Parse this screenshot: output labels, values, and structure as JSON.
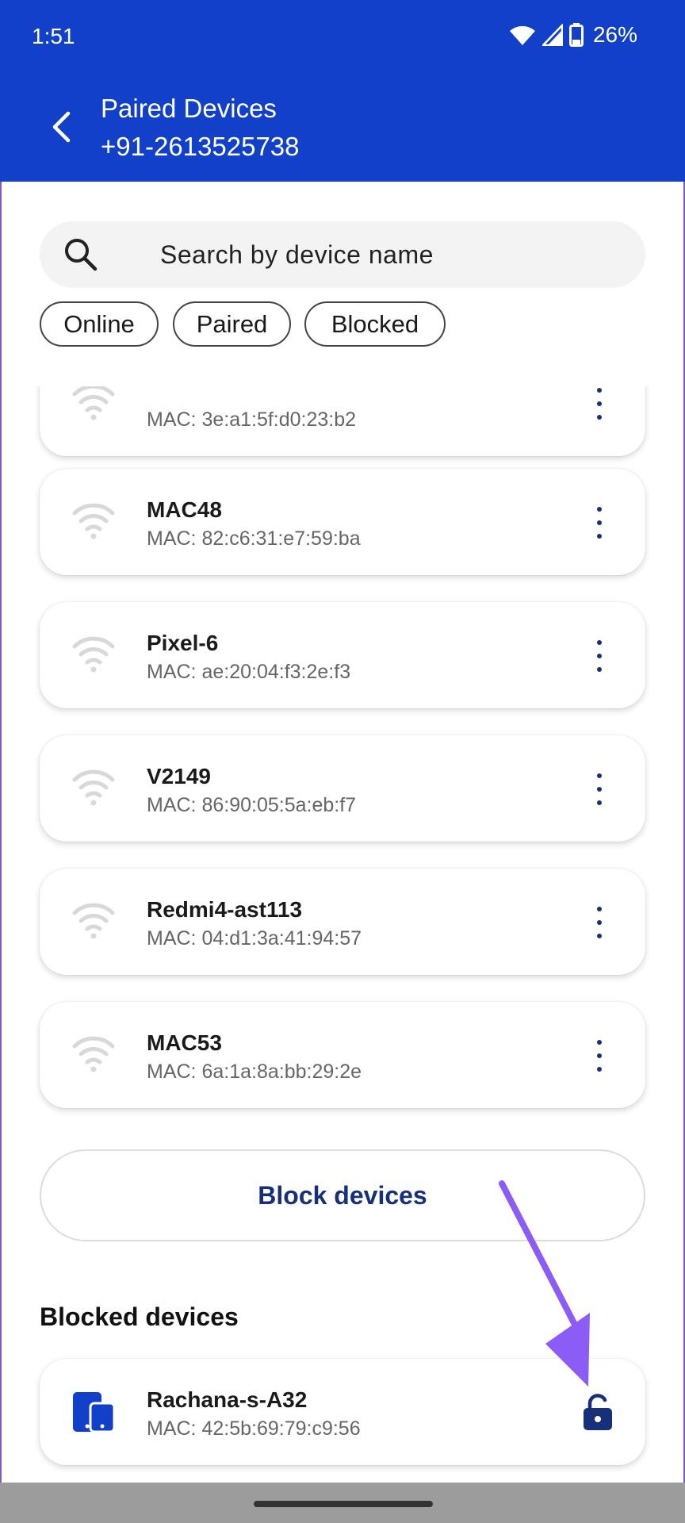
{
  "status_bar": {
    "time": "1:51",
    "battery": "26%",
    "icons": [
      "wifi-icon",
      "cell-signal-icon",
      "battery-icon"
    ]
  },
  "header": {
    "title": "Paired Devices",
    "subtitle": "+91-2613525738",
    "back_icon": "back-arrow-icon"
  },
  "search": {
    "placeholder": "Search by device name",
    "icon": "search-icon"
  },
  "filters": [
    {
      "label": "Online"
    },
    {
      "label": "Paired"
    },
    {
      "label": "Blocked"
    }
  ],
  "devices": [
    {
      "name": "",
      "mac": "MAC: 3e:a1:5f:d0:23:b2"
    },
    {
      "name": "MAC48",
      "mac": "MAC: 82:c6:31:e7:59:ba"
    },
    {
      "name": "Pixel-6",
      "mac": "MAC: ae:20:04:f3:2e:f3"
    },
    {
      "name": "V2149",
      "mac": "MAC: 86:90:05:5a:eb:f7"
    },
    {
      "name": "Redmi4-ast113",
      "mac": "MAC: 04:d1:3a:41:94:57"
    },
    {
      "name": "MAC53",
      "mac": "MAC: 6a:1a:8a:bb:29:2e"
    }
  ],
  "block_button": {
    "label": "Block devices"
  },
  "blocked_section": {
    "title": "Blocked devices",
    "devices": [
      {
        "name": "Rachana-s-A32",
        "mac": "MAC: 42:5b:69:79:c9:56"
      }
    ]
  },
  "colors": {
    "header_bg": "#1240c8",
    "accent_dark": "#17307a",
    "annotation_arrow": "#8b5cf6"
  }
}
